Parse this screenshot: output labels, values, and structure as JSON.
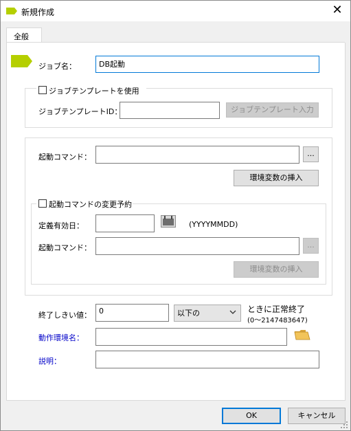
{
  "window": {
    "title": "新規作成"
  },
  "tabs": [
    {
      "label": "全般"
    }
  ],
  "job": {
    "label": "ジョブ名：",
    "value": "DB起動"
  },
  "template": {
    "checkbox_label": "ジョブテンプレートを使用",
    "id_label": "ジョブテンプレートID：",
    "id_value": "",
    "button": "ジョブテンプレート入力"
  },
  "command": {
    "label": "起動コマンド：",
    "value": "",
    "browse": "...",
    "env_button": "環境変数の挿入"
  },
  "reserve": {
    "checkbox_label": "起動コマンドの変更予約",
    "date_label": "定義有効日：",
    "date_value": "",
    "date_format": "(YYYYMMDD)",
    "command_label": "起動コマンド：",
    "command_value": "",
    "browse": "...",
    "env_button": "環境変数の挿入"
  },
  "threshold": {
    "label": "終了しきい値：",
    "value": "0",
    "condition": "以下の",
    "suffix": "ときに正常終了",
    "range": "(0〜2147483647)"
  },
  "environment": {
    "label": "動作環境名：",
    "value": ""
  },
  "description": {
    "label": "説明：",
    "value": ""
  },
  "footer": {
    "ok": "OK",
    "cancel": "キャンセル"
  },
  "colors": {
    "accent": "#b5cf00",
    "link_label": "#0000c8",
    "focus": "#0078d7"
  }
}
